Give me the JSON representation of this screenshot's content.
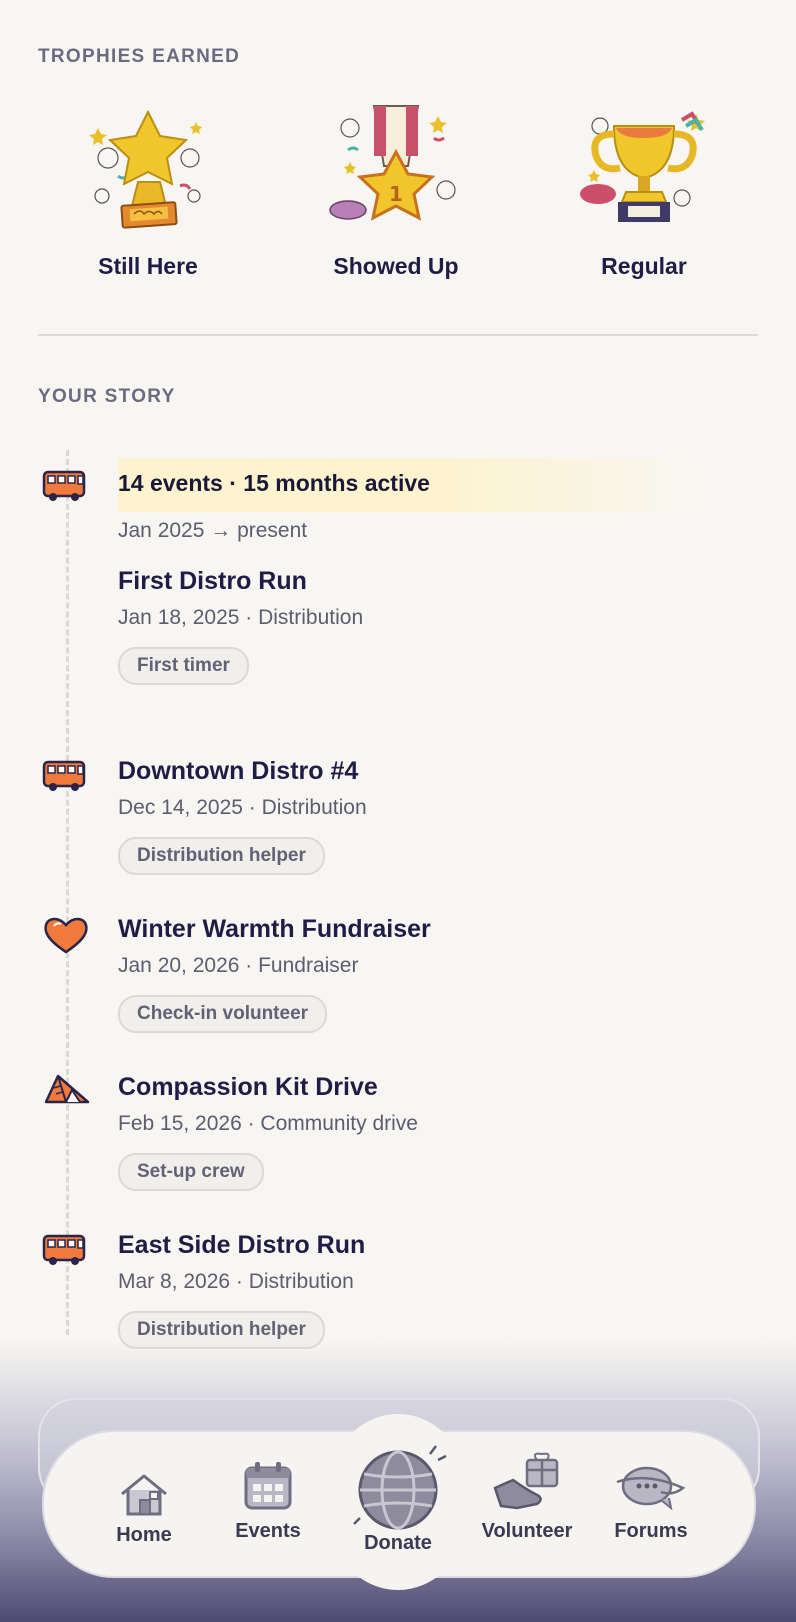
{
  "trophies": {
    "heading": "TROPHIES EARNED",
    "items": [
      {
        "name": "Still Here",
        "icon": "star-trophy-icon"
      },
      {
        "name": "Showed Up",
        "icon": "star-medal-icon"
      },
      {
        "name": "Regular",
        "icon": "gold-cup-icon"
      }
    ]
  },
  "story": {
    "heading": "YOUR STORY",
    "summary": "14 events · 15 months active",
    "range": "Jan 2025 → present",
    "events": [
      {
        "title": "First Distro Run",
        "meta": "Jan 18, 2025 · Distribution",
        "role": "First timer",
        "icon": "bus-icon"
      },
      {
        "title": "Downtown Distro #4",
        "meta": "Dec 14, 2025 · Distribution",
        "role": "Distribution helper",
        "icon": "bus-icon"
      },
      {
        "title": "Winter Warmth Fundraiser",
        "meta": "Jan 20, 2026 · Fundraiser",
        "role": "Check-in volunteer",
        "icon": "heart-icon"
      },
      {
        "title": "Compassion Kit Drive",
        "meta": "Feb 15, 2026 · Community drive",
        "role": "Set-up crew",
        "icon": "tent-icon"
      },
      {
        "title": "East Side Distro Run",
        "meta": "Mar 8, 2026 · Distribution",
        "role": "Distribution helper",
        "icon": "bus-icon"
      }
    ]
  },
  "nav": {
    "items": [
      {
        "label": "Home",
        "icon": "house-icon"
      },
      {
        "label": "Events",
        "icon": "calendar-icon"
      },
      {
        "label": "Donate",
        "icon": "globe-icon"
      },
      {
        "label": "Volunteer",
        "icon": "gift-hand-icon"
      },
      {
        "label": "Forums",
        "icon": "chat-planet-icon"
      }
    ]
  },
  "colors": {
    "background": "#f8f6f2",
    "ink": "#1f1d45",
    "accent_orange": "#f07a3e",
    "gold": "#e9c02a",
    "highlight": "#fdf3cf"
  }
}
